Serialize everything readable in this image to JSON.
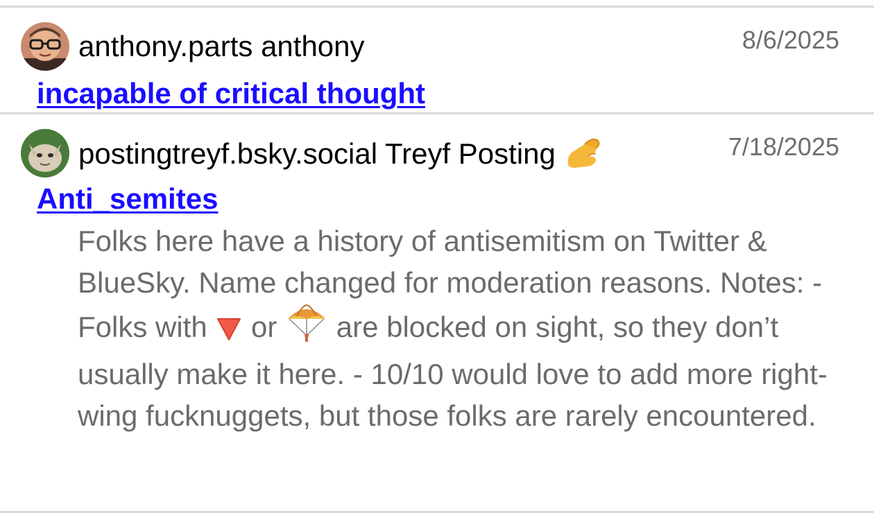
{
  "entries": [
    {
      "handle": "anthony.parts",
      "display_name": "anthony",
      "date": "8/6/2025",
      "list_name": "incapable of critical thought",
      "avatar_icon": "person-with-glasses-avatar-icon"
    },
    {
      "handle": "postingtreyf.bsky.social",
      "display_name": "Treyf Posting",
      "display_name_emoji": "pinching-hand-icon",
      "date": "7/18/2025",
      "list_name": "Anti_semites",
      "avatar_icon": "creature-avatar-icon",
      "description": {
        "part1": "Folks here have a history of antisemitism on Twitter & BlueSky. Name changed for moderation reasons. Notes: - Folks with",
        "icon1": "red-triangle-down-icon",
        "part2": "or",
        "icon2": "parachute-icon",
        "part3": "are blocked on sight, so they don’t usually make it here. - 10/10 would love to add more right-wing fucknuggets, but those folks are rarely encountered."
      }
    }
  ],
  "colors": {
    "link": "#1a0dff",
    "date": "#6e6e6e",
    "description": "#6b6b6b",
    "divider": "#d9d9d9"
  }
}
